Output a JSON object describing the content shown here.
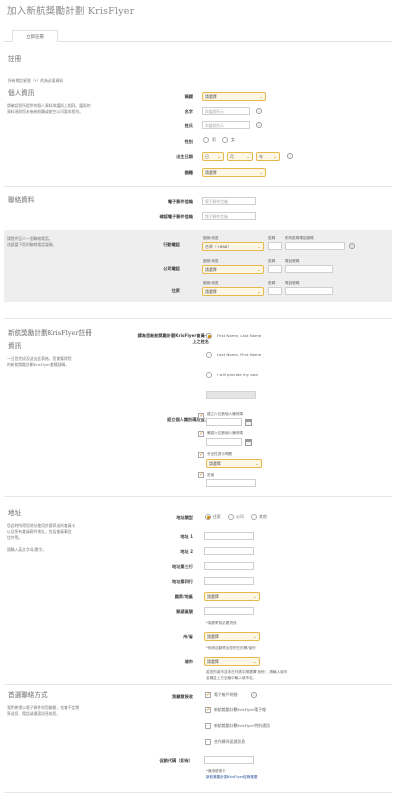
{
  "page": {
    "title": "加入新航獎勵計劃 KrisFlyer"
  },
  "tabs": [
    {
      "label": "立即註冊"
    }
  ],
  "register": {
    "title": "註冊",
    "required_note": "所有標註星號（*）的為必填資料"
  },
  "personal": {
    "title": "個人資訊",
    "note_1": "請確認您所提供的個人資料與護照上相同。護照的",
    "note_2": "資料須與您未來新航購或航空公司要求相符。",
    "title_label": "稱謂",
    "title_value": "請選擇",
    "given_name_label": "名字",
    "given_name_placeholder": "與護照所示",
    "surname_label": "姓氏",
    "surname_placeholder": "與護照所示",
    "gender_label": "性別",
    "gender_male": "男",
    "gender_female": "女",
    "dob_label": "出生日期",
    "dob_day": "日",
    "dob_month": "月",
    "dob_year": "年",
    "nationality_label": "國籍",
    "nationality_value": "請選擇"
  },
  "contact": {
    "title": "聯絡資料",
    "email_label": "電子郵件信箱",
    "email_placeholder": "電子郵件信箱",
    "confirm_email_label": "確認電子郵件信箱",
    "confirm_email_placeholder": "電子郵件信箱",
    "phone_note_1": "請提供至少一個聯絡電話。",
    "phone_note_2": "這讓當下您的聯絡電話號碼。",
    "mobile_label": "行動電話",
    "office_label": "公司電話",
    "home_label": "住家",
    "country_code_label": "國家/地區",
    "area_code_label": "區碼",
    "number_label": "電話號碼",
    "mobile_number_label": "附有區碼電話號碼",
    "mobile_country_value": "台灣（+886）",
    "office_country_value": "請選擇",
    "home_country_value": "請選擇"
  },
  "krisflyer": {
    "title_1": "新航獎勵計劃KrisFlyer註冊",
    "title_2": "資訊",
    "note_1": "一旦您完成及送出此表格，您會獲得您",
    "note_2": "的新航獎勵計劃KrisFlyer會籍號碼。",
    "card_name_label_1": "請為您新航獎勵計劃KrisFlyer會員卡",
    "card_name_label_2": "上之姓名",
    "name_option_1": "First Name, Last Name",
    "name_option_2": "Last Name, First Name",
    "name_option_3": "I will provide my own",
    "security_label": "設立個人識別碼及登入",
    "pin_label": "建立六位數個人識別碼",
    "confirm_pin_label": "確認六位數個人識別碼",
    "question_label": "安全性提示問題",
    "question_value": "請選擇",
    "answer_label": "答案"
  },
  "address": {
    "title": "地址",
    "note_1": "您此時所得您地址使用於要寄送的會員卡",
    "note_2": "以及所有會員郵件地址，包括會員事宜",
    "note_3": "信件等。",
    "note_4": "請輸入英文字母/數字。",
    "type_label": "地址類型",
    "type_home": "住家",
    "type_office": "公司",
    "type_other": "其他",
    "line1_label": "地址 1",
    "line2_label": "地址 2",
    "line3_label": "地址第三行",
    "line4_label": "地址第四行",
    "country_label": "國家/地區",
    "country_value": "請選擇",
    "postal_label": "郵遞區號",
    "postal_note": "*為郵寄前必要資訊",
    "state_label": "州/省",
    "state_value": "請選擇",
    "state_note": "*系統自動帶出您所在的縣/省份",
    "city_label": "城市",
    "city_value": "請選擇",
    "city_note_1": "若您的城市並未在列表中請選擇‘其他’，請輸入城市",
    "city_note_2": "名稱並上方空格中輸入城市名。"
  },
  "preferences": {
    "title": "首選聯絡方式",
    "note_1": "我們希望以電子郵件與您聯繫，也會不定期",
    "note_2": "寄送您、電話或優惠訊息給您。",
    "receive_label": "我願意接收",
    "option_1": "電子帳戶明細",
    "option_2": "新航獎勵計劃KrisFlyer電子報",
    "option_3": "新航獎勵計劃KrisFlyer特別通訊",
    "option_4": "合作夥伴促銷訊息",
    "promo_label": "促銷代碼（如有）",
    "promo_note_1": "*適用優惠卡",
    "promo_note_2": "新航獎勵計劃KrisFlyer促銷推廣"
  }
}
